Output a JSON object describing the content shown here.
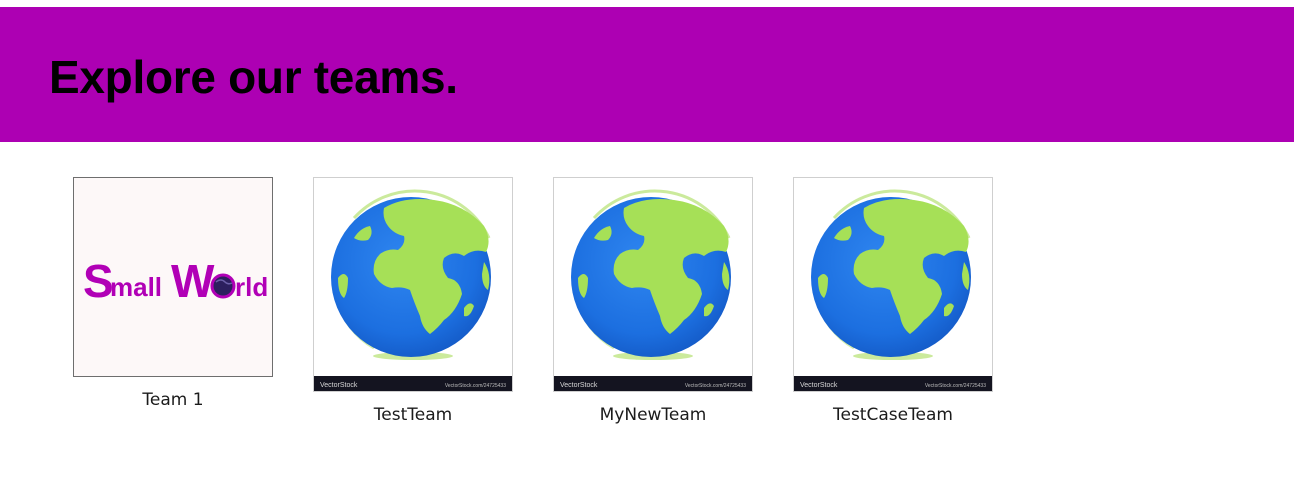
{
  "header": {
    "title": "Explore our teams.",
    "background_color": "#ad00b3"
  },
  "teams": [
    {
      "name": "Team 1",
      "image": {
        "type": "logo",
        "logo_text_part1": "S",
        "logo_text_part2": "mall",
        "logo_text_part3": "W",
        "logo_text_part4": "rld",
        "logo_color": "#b100b6"
      }
    },
    {
      "name": "TestTeam",
      "image": {
        "type": "globe",
        "watermark_left": "VectorStock",
        "watermark_right": "VectorStock.com/24725433"
      }
    },
    {
      "name": "MyNewTeam",
      "image": {
        "type": "globe",
        "watermark_left": "VectorStock",
        "watermark_right": "VectorStock.com/24725433"
      }
    },
    {
      "name": "TestCaseTeam",
      "image": {
        "type": "globe",
        "watermark_left": "VectorStock",
        "watermark_right": "VectorStock.com/24725433"
      }
    }
  ]
}
